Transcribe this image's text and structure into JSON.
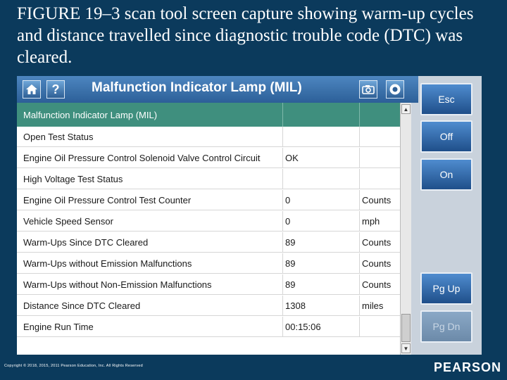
{
  "caption": "FIGURE 19–3 scan tool screen capture showing warm-up cycles and distance travelled since diagnostic trouble code (DTC) was cleared.",
  "window": {
    "title": "Malfunction Indicator Lamp (MIL)",
    "help_label": "?"
  },
  "table": {
    "header": {
      "name": "Malfunction Indicator Lamp (MIL)",
      "value": "",
      "unit": ""
    },
    "rows": [
      {
        "name": "Open Test Status",
        "value": "",
        "unit": ""
      },
      {
        "name": "Engine Oil Pressure Control Solenoid Valve Control Circuit",
        "value": "OK",
        "unit": ""
      },
      {
        "name": "High Voltage Test Status",
        "value": "",
        "unit": ""
      },
      {
        "name": "Engine Oil Pressure Control Test Counter",
        "value": "0",
        "unit": "Counts"
      },
      {
        "name": "Vehicle Speed Sensor",
        "value": "0",
        "unit": "mph"
      },
      {
        "name": "Warm-Ups Since DTC Cleared",
        "value": "89",
        "unit": "Counts"
      },
      {
        "name": "Warm-Ups without Emission Malfunctions",
        "value": "89",
        "unit": "Counts"
      },
      {
        "name": "Warm-Ups without Non-Emission Malfunctions",
        "value": "89",
        "unit": "Counts"
      },
      {
        "name": "Distance Since DTC Cleared",
        "value": "1308",
        "unit": "miles"
      },
      {
        "name": "Engine Run Time",
        "value": "00:15:06",
        "unit": ""
      }
    ]
  },
  "side_buttons": {
    "esc": "Esc",
    "off": "Off",
    "on": "On",
    "pg_up": "Pg Up",
    "pg_dn": "Pg Dn"
  },
  "footer": {
    "copyright": "Copyright © 2018, 2015, 2011 Pearson Education, Inc. All Rights Reserved",
    "brand": "PEARSON"
  }
}
